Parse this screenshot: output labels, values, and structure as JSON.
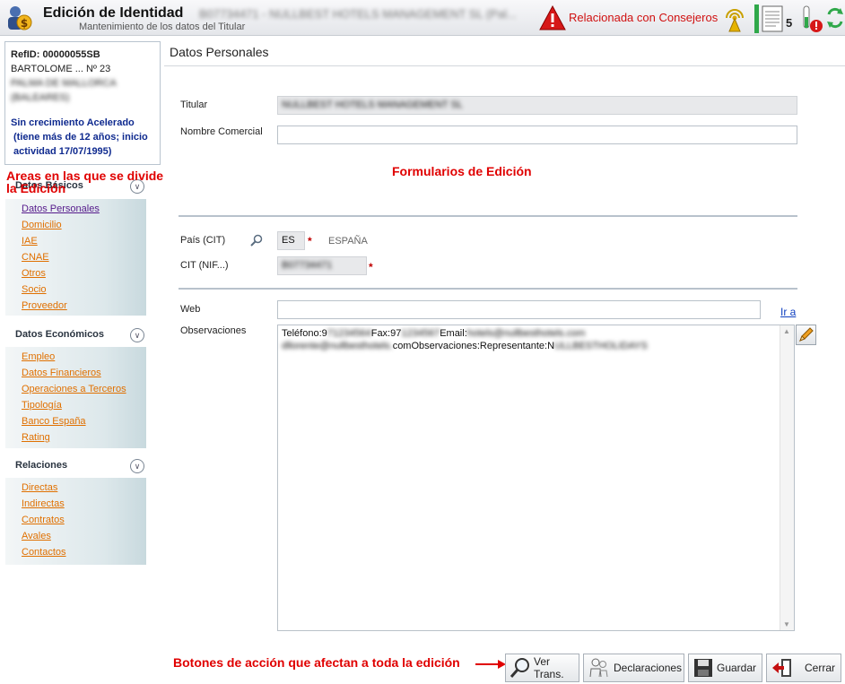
{
  "header": {
    "title": "Edición de Identidad",
    "subtitle": "Mantenimiento de los datos del Titular",
    "record_text": "B07734471 - NULLBEST HOTELS MANAGEMENT SL (Pal...",
    "warning": "Relacionada con Consejeros",
    "doc_count": "5"
  },
  "ref_box": {
    "ref_id": "RefID: 00000055SB",
    "address1": "BARTOLOME ... Nº 23",
    "address2": "PALMA DE MALLORCA",
    "address3": "(BALEARES)",
    "growth": "Sin crecimiento Acelerado",
    "growth_detail": "(tiene más de 12 años; inicio actividad 17/07/1995)"
  },
  "annotations": {
    "areas": "Areas en las que se divide la Edición",
    "forms": "Formularios de Edición",
    "buttons": "Botones de acción que afectan a toda la edición"
  },
  "sections": [
    {
      "title": "Datos Básicos",
      "items": [
        "Datos Personales",
        "Domicilio",
        "IAE",
        "CNAE",
        "Otros",
        "Socio",
        "Proveedor"
      ]
    },
    {
      "title": "Datos Económicos",
      "items": [
        "Empleo",
        "Datos Financieros",
        "Operaciones a Terceros",
        "Tipología",
        "Banco España",
        "Rating"
      ]
    },
    {
      "title": "Relaciones",
      "items": [
        "Directas",
        "Indirectas",
        "Contratos",
        "Avales",
        "Contactos"
      ]
    }
  ],
  "form": {
    "title": "Datos Personales",
    "titular_label": "Titular",
    "titular_value": "NULLBEST HOTELS MANAGEMENT SL",
    "nombre_comercial_label": "Nombre Comercial",
    "nombre_comercial_value": "",
    "pais_label": "País (CIT)",
    "pais_value": "ES",
    "pais_name": "ESPAÑA",
    "cit_label": "CIT (NIF...)",
    "cit_value": "B07734471",
    "required_mark": "*",
    "web_label": "Web",
    "web_value": "",
    "ir_a": "Ir a",
    "obs_label": "Observaciones",
    "obs_line1_a": "Teléfono:9",
    "obs_line1_b": "71234564",
    "obs_line1_c": "Fax:97",
    "obs_line1_d": "1234567",
    "obs_line1_e": "Email:",
    "obs_line1_f": "hotels@nullbesthotels.com",
    "obs_line2_a": "dllorente@nullbesthotels.",
    "obs_line2_b": "comObservaciones:Representante:N",
    "obs_line2_c": "ULLBESTHOLIDAYS"
  },
  "buttons": {
    "ver": "Ver Trans.",
    "decl": "Declaraciones",
    "guardar": "Guardar",
    "cerrar": "Cerrar"
  }
}
